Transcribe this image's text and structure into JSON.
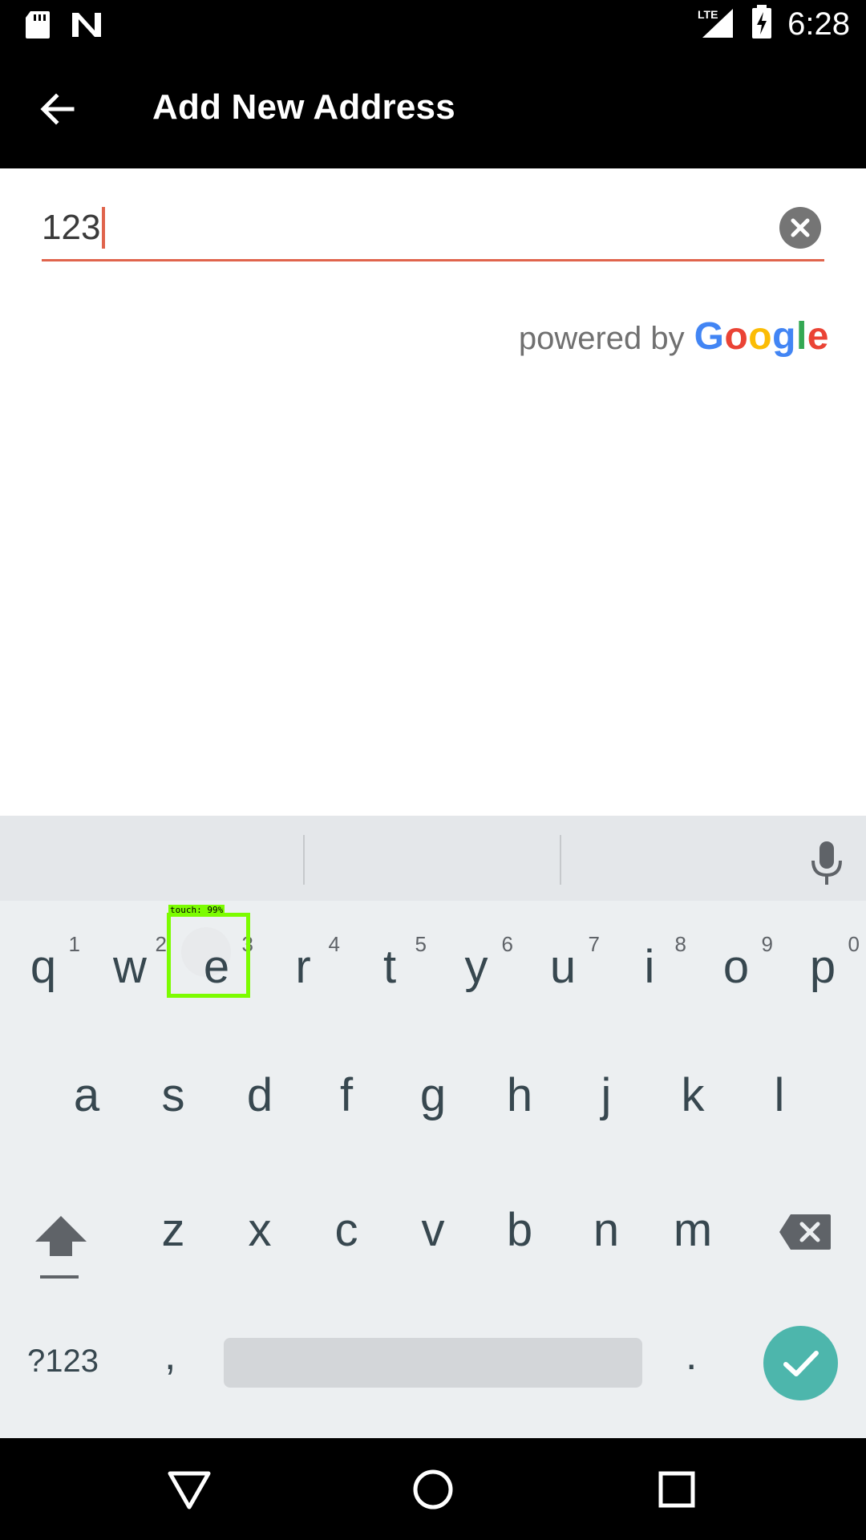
{
  "status_bar": {
    "time": "6:28",
    "network": "LTE",
    "icons": [
      "sd-card-icon",
      "n-logo-icon",
      "lte-signal-icon",
      "battery-charging-icon"
    ]
  },
  "toolbar": {
    "back_icon": "arrow-left-icon",
    "title": "Add New Address"
  },
  "search": {
    "value": "123",
    "clear_icon": "clear-circle-icon",
    "accent_color": "#e0644c"
  },
  "attribution": {
    "powered_by": "powered by",
    "brand_letters": [
      {
        "ch": "G",
        "color": "#4285F4"
      },
      {
        "ch": "o",
        "color": "#EA4335"
      },
      {
        "ch": "o",
        "color": "#FBBC05"
      },
      {
        "ch": "g",
        "color": "#4285F4"
      },
      {
        "ch": "l",
        "color": "#34A853"
      },
      {
        "ch": "e",
        "color": "#EA4335"
      }
    ]
  },
  "keyboard": {
    "mic_icon": "microphone-icon",
    "row1": [
      {
        "ch": "q",
        "hint": "1"
      },
      {
        "ch": "w",
        "hint": "2"
      },
      {
        "ch": "e",
        "hint": "3"
      },
      {
        "ch": "r",
        "hint": "4"
      },
      {
        "ch": "t",
        "hint": "5"
      },
      {
        "ch": "y",
        "hint": "6"
      },
      {
        "ch": "u",
        "hint": "7"
      },
      {
        "ch": "i",
        "hint": "8"
      },
      {
        "ch": "o",
        "hint": "9"
      },
      {
        "ch": "p",
        "hint": "0"
      }
    ],
    "row2": [
      "a",
      "s",
      "d",
      "f",
      "g",
      "h",
      "j",
      "k",
      "l"
    ],
    "row3": [
      "z",
      "x",
      "c",
      "v",
      "b",
      "n",
      "m"
    ],
    "symbols_label": "?123",
    "comma": ",",
    "period": ".",
    "touch_label": "touch: 99%",
    "enter_color": "#4db6ac"
  },
  "nav_bar": {
    "icons": [
      "back-triangle-icon",
      "home-circle-icon",
      "recents-square-icon"
    ]
  }
}
